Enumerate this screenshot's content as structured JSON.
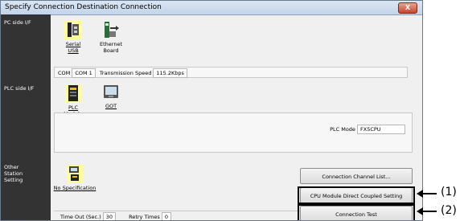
{
  "window": {
    "title": "Specify Connection Destination Connection",
    "close_glyph": "X"
  },
  "side_labels": {
    "pc_side": "PC side I/F",
    "plc_side": "PLC side I/F",
    "other_station": "Other\nStation\nSetting"
  },
  "pc_side": {
    "items": [
      {
        "label": "Serial\nUSB",
        "icon": "serial-usb-icon",
        "selected": true
      },
      {
        "label": "Ethernet\nBoard",
        "icon": "ethernet-board-icon",
        "selected": false
      }
    ],
    "com_label": "COM",
    "com_value": "COM 1",
    "speed_label": "Transmission Speed",
    "speed_value": "115.2Kbps"
  },
  "plc_side": {
    "items": [
      {
        "label": "PLC\nModule",
        "icon": "plc-module-icon",
        "selected": true
      },
      {
        "label": "GOT",
        "icon": "got-icon",
        "selected": false
      }
    ],
    "plc_mode_label": "PLC Mode",
    "plc_mode_value": "FX5CPU"
  },
  "other_station": {
    "item": {
      "label": "No Specification",
      "icon": "no-specification-icon",
      "selected": true
    },
    "timeout_label": "Time Out (Sec.)",
    "timeout_value": "30",
    "retry_label": "Retry Times",
    "retry_value": "0"
  },
  "buttons": {
    "channel_list": "Connection Channel List...",
    "cpu_direct": "CPU Module Direct Coupled Setting",
    "connection_test": "Connection Test"
  },
  "callouts": {
    "one": "(1)",
    "two": "(2)"
  },
  "colors": {
    "side_pane": "#333333",
    "selected_highlight": "#ffff99"
  }
}
